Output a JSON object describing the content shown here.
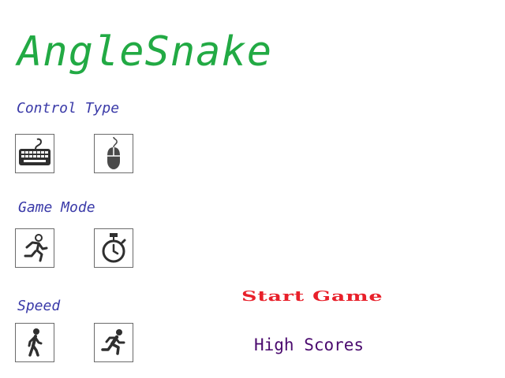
{
  "title": "AngleSnake",
  "sections": {
    "control_type": {
      "label": "Control Type",
      "options": [
        "keyboard-icon",
        "mouse-icon"
      ]
    },
    "game_mode": {
      "label": "Game Mode",
      "options": [
        "running-person-icon",
        "stopwatch-icon"
      ]
    },
    "speed": {
      "label": "Speed",
      "options": [
        "walking-person-icon",
        "sprinting-person-icon"
      ]
    }
  },
  "menu": {
    "start_label": "Start Game",
    "high_scores_label": "High Scores"
  },
  "colors": {
    "title": "#22aa44",
    "section_label": "#3a3aa8",
    "start": "#e8202a",
    "high_scores": "#4a0a6e",
    "icon": "#2f2f2f",
    "button_border": "#6b6b6b",
    "background": "#ffffff"
  }
}
